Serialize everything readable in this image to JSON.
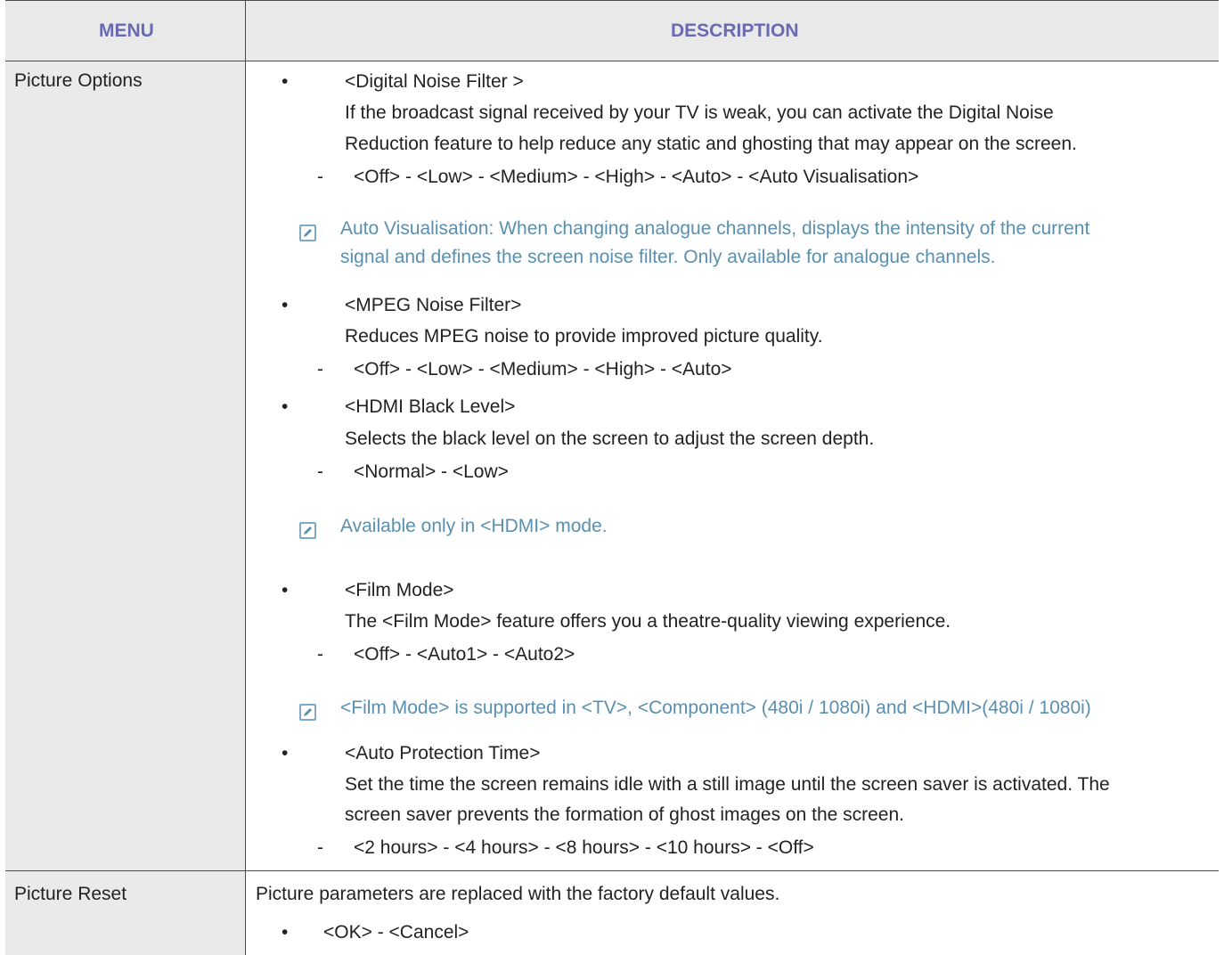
{
  "header": {
    "menu": "MENU",
    "description": "DESCRIPTION"
  },
  "rows": {
    "picture_options": {
      "menu": "Picture Options",
      "digital_noise": {
        "title": "<Digital Noise Filter >",
        "desc1": "If the broadcast signal received by your TV is weak, you can activate the Digital Noise",
        "desc2": "Reduction feature to help reduce any static and ghosting that may appear on the screen.",
        "options": "<Off> - <Low> - <Medium> - <High> - <Auto> - <Auto Visualisation>",
        "note1": "Auto Visualisation: When changing analogue channels, displays the intensity of the current",
        "note2": "signal and defines the screen noise filter. Only available for analogue channels."
      },
      "mpeg_noise": {
        "title": "<MPEG Noise Filter>",
        "desc": "Reduces MPEG noise to provide improved picture quality.",
        "options": "<Off> - <Low> - <Medium> - <High> - <Auto>"
      },
      "hdmi_black": {
        "title": "<HDMI Black Level>",
        "desc": "Selects the black level on the screen to adjust the screen depth.",
        "options": "<Normal> - <Low>",
        "note": "Available only in <HDMI> mode."
      },
      "film_mode": {
        "title": "<Film Mode>",
        "desc": "The <Film Mode> feature offers you a theatre-quality viewing experience.",
        "options": "<Off> - <Auto1> - <Auto2>",
        "note": "<Film Mode> is supported in <TV>, <Component> (480i / 1080i) and <HDMI>(480i / 1080i)"
      },
      "auto_protection": {
        "title": "<Auto Protection Time>",
        "desc1": "Set the time the screen remains idle with a still image until the screen saver is activated. The",
        "desc2": "screen saver prevents the formation of ghost images on the screen.",
        "options": "<2 hours> - <4 hours> - <8 hours> - <10 hours> - <Off>"
      }
    },
    "picture_reset": {
      "menu": "Picture Reset",
      "desc": "Picture parameters are replaced with the factory default values.",
      "options": "<OK> - <Cancel>"
    }
  },
  "glyphs": {
    "bullet": "•",
    "dash": "-"
  },
  "colors": {
    "header_text": "#6a6ab2",
    "note_text": "#5a8fb0",
    "header_bg": "#e9e9e9",
    "menu_bg": "#eaeaea"
  }
}
